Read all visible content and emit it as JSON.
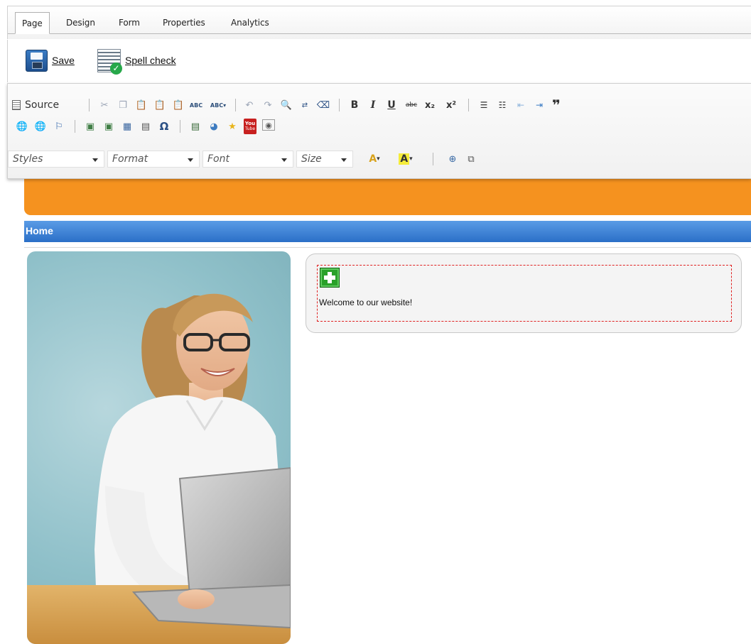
{
  "tabs": [
    {
      "label": "Page",
      "active": true
    },
    {
      "label": "Design",
      "active": false
    },
    {
      "label": "Form",
      "active": false
    },
    {
      "label": "Properties",
      "active": false
    },
    {
      "label": "Analytics",
      "active": false
    }
  ],
  "actions": {
    "save_label": "Save",
    "spell_check_label": "Spell check"
  },
  "toolbar": {
    "source_label": "Source",
    "row1_icons": [
      "cut-icon",
      "copy-icon",
      "paste-icon",
      "paste-text-icon",
      "paste-word-icon",
      "spellcheck-icon",
      "spellcheck-dropdown-icon",
      "undo-icon",
      "redo-icon",
      "find-icon",
      "replace-icon",
      "remove-format-icon",
      "bold-icon",
      "italic-icon",
      "underline-icon",
      "strikethrough-icon",
      "subscript-icon",
      "superscript-icon",
      "numbered-list-icon",
      "bulleted-list-icon",
      "outdent-icon",
      "indent-icon",
      "blockquote-icon"
    ],
    "row2_icons": [
      "link-icon",
      "unlink-icon",
      "anchor-icon",
      "image-icon",
      "insert-image-icon",
      "table-icon",
      "horizontal-rule-icon",
      "special-char-icon",
      "page-break-icon",
      "media-icon",
      "widget-star-icon",
      "youtube-icon",
      "inline-widget-icon"
    ],
    "combos": {
      "styles": "Styles",
      "format": "Format",
      "font": "Font",
      "size": "Size"
    },
    "row3_icons": [
      "text-color-icon",
      "background-color-icon",
      "maximize-icon",
      "show-blocks-icon"
    ],
    "glyphs": {
      "bold": "B",
      "italic": "I",
      "underline": "U",
      "strike": "abc",
      "subscript": "x₂",
      "superscript": "x²",
      "special": "Ω",
      "text_color": "A",
      "bg_color": "A",
      "spell": "ABC",
      "youtube_top": "You",
      "youtube_bottom": "Tube"
    }
  },
  "page": {
    "breadcrumb_home": "Home",
    "welcome_text": "Welcome to our website!"
  },
  "colors": {
    "banner": "#f5921f",
    "nav": "#2b6fc7",
    "edit_border": "#e02020",
    "add_button": "#2aa12a"
  }
}
